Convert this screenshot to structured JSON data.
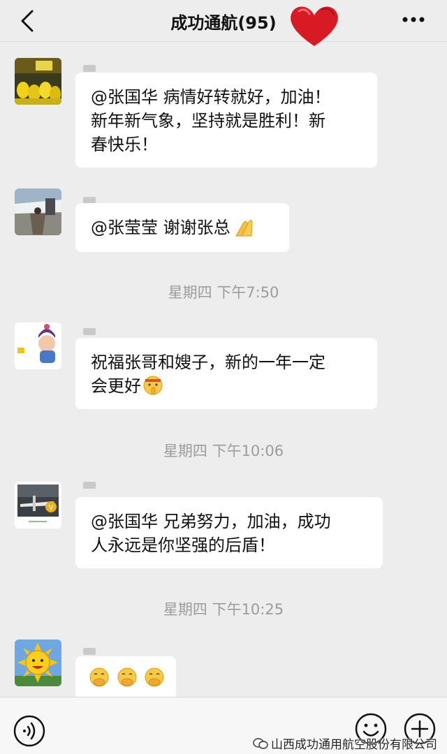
{
  "header": {
    "title": "成功通航(95)",
    "back_icon": "chevron-left-icon",
    "more_icon": "more-dots-icon",
    "decoration": "red-heart"
  },
  "messages": [
    {
      "avatar": "avatar-yellow-crowd",
      "lines": [
        "@张国华 病情好转就好，加油！",
        "新年新气象，坚持就是胜利！新",
        "春快乐！"
      ]
    },
    {
      "avatar": "avatar-airplane-door",
      "lines": [
        "@张莹莹 谢谢张总"
      ],
      "emoji": "praying-hands"
    },
    {
      "time": "星期四 下午7:50"
    },
    {
      "avatar": "avatar-baby",
      "lines": [
        "祝福张哥和嫂子，新的一年一定",
        "会更好"
      ],
      "emoji": "shushing-face"
    },
    {
      "time": "星期四 下午10:06"
    },
    {
      "avatar": "avatar-aircraft",
      "lines": [
        "@张国华 兄弟努力，加油，成功",
        "人永远是你坚强的后盾！"
      ]
    },
    {
      "time": "星期四 下午10:25"
    },
    {
      "avatar": "avatar-sun",
      "emoji": "hand-over-mouth x3"
    }
  ],
  "bottom_bar": {
    "voice_icon": "voice-icon",
    "emoji_icon": "emoji-icon",
    "plus_icon": "plus-icon"
  },
  "watermark": {
    "text": "山西成功通用航空股份有限公司",
    "icon": "wechat-official-icon"
  }
}
